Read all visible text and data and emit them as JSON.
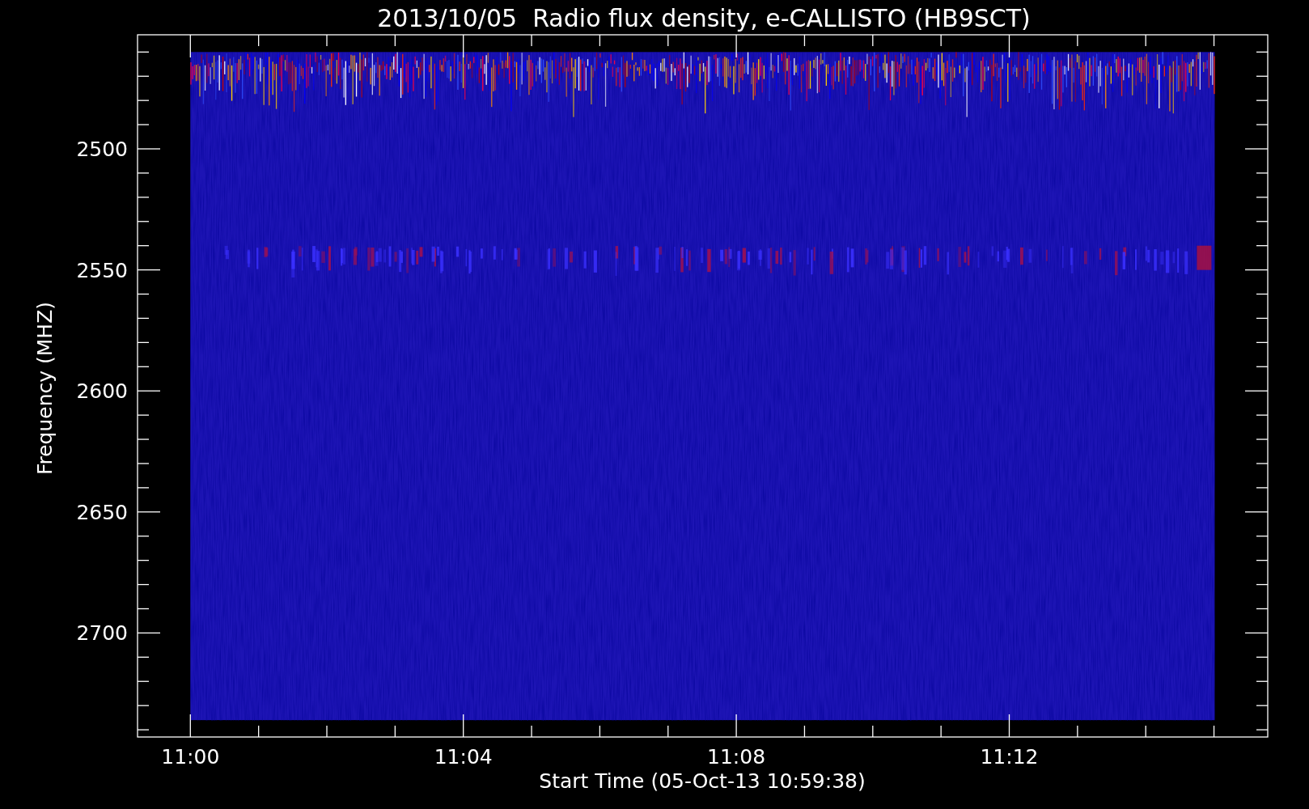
{
  "title": "2013/10/05  Radio flux density, e-CALLISTO (HB9SCT)",
  "plot": {
    "ylabel": "Frequency (MHZ)",
    "xlabel": "Start Time (05-Oct-13 10:59:38)",
    "y_tick_labels": [
      "2500",
      "2550",
      "2600",
      "2650",
      "2700"
    ],
    "x_tick_labels": [
      "11:00",
      "11:04",
      "11:08",
      "11:12"
    ]
  }
}
